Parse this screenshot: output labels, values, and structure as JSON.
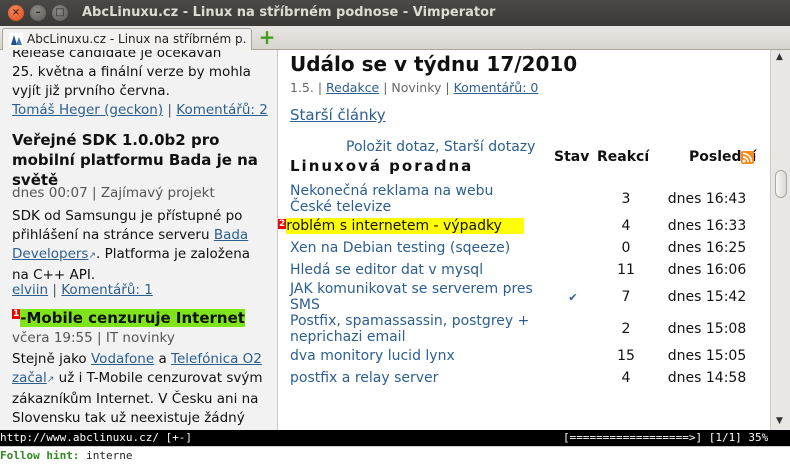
{
  "window": {
    "title": "AbcLinuxu.cz - Linux na stříbrném podnose - Vimperator"
  },
  "tabs": [
    {
      "label": "AbcLinuxu.cz - Linux na stříbrném p..."
    }
  ],
  "left": {
    "release_line1": "Release candidate je očekáván",
    "release_line2": "25. května a finální verze by mohla",
    "release_line3": "vyjít již prvního června.",
    "article1_author": "Tomáš Heger (geckon)",
    "article1_comments": "Komentářů: 2",
    "article2_title_l1": "Veřejné SDK 1.0.0b2 pro",
    "article2_title_l2": "mobilní platformu Bada je na",
    "article2_title_l3": "světě",
    "article2_meta_time": "dnes 00:07",
    "article2_meta_cat": "Zajímavý projekt",
    "article2_body_l1": "SDK od Samsungu je přístupné po",
    "article2_body_l2a": "přihlášení na stránce serveru",
    "article2_body_link1": "Bada",
    "article2_body_link2": "Developers",
    "article2_body_l3b": ". Platforma je založena",
    "article2_body_l4": "na C++ API.",
    "article2_author": "elviin",
    "article2_comments": "Komentářů: 1",
    "article3_hint": "1",
    "article3_title": "-Mobile cenzuruje Internet",
    "article3_meta_time": "včera 19:55",
    "article3_meta_cat": "IT novinky",
    "article3_body_l1a": "Stejně jako",
    "article3_link1": "Vodafone",
    "article3_body_a": "a",
    "article3_link2": "Telefónica O2",
    "article3_link3": "začal",
    "article3_body_l2b": " už i T-Mobile cenzurovat svým",
    "article3_body_l3": "zákazníkům Internet. V Česku ani na",
    "article3_body_l4": "Slovensku tak už neexistuje žádný"
  },
  "right": {
    "heading": "Událo se v týdnu 17/2010",
    "meta_date": "1.5.",
    "meta_link": "Redakce",
    "meta_cat": "Novinky",
    "meta_comments": "Komentářů: 0",
    "older": "Starší články",
    "ask": "Položit dotaz",
    "older_questions": "Starší dotazy",
    "section_title": "Linuxová poradna",
    "col_stav": "Stav",
    "col_reakci": "Reakcí",
    "col_posledni": "Poslední",
    "rows": [
      {
        "title_l1": "Nekonečná reklama na webu",
        "title_l2": "České televize",
        "count": "3",
        "time": "dnes 16:43"
      },
      {
        "hint": "2",
        "title_l1": "roblém s internetem - výpadky",
        "count": "4",
        "time": "dnes 16:33"
      },
      {
        "title_l1": "Xen na Debian testing (sqeeze)",
        "count": "0",
        "time": "dnes 16:25"
      },
      {
        "title_l1": "Hledá se editor dat v mysql",
        "count": "11",
        "time": "dnes 16:06"
      },
      {
        "title_l1": "JAK komunikovat se serverem pres",
        "title_l2": "SMS",
        "stav": "✔",
        "count": "7",
        "time": "dnes 15:42"
      },
      {
        "title_l1": "Postfix, spamassassin, postgrey +",
        "title_l2": "neprichazi email",
        "count": "2",
        "time": "dnes 15:08"
      },
      {
        "title_l1": "dva monitory lucid lynx",
        "count": "15",
        "time": "dnes 15:05"
      },
      {
        "title_l1": "postfix a relay server",
        "count": "4",
        "time": "dnes 14:58"
      }
    ]
  },
  "statusbar": {
    "url": "http://www.abclinuxu.cz/ [+-]",
    "progress": "[==================>] [1/1] 35%",
    "hint_label": "Follow hint:",
    "hint_value": "interne"
  },
  "colors": {
    "link": "#2c5f8f",
    "hint_green": "#7ee51d",
    "hint_yellow": "#ffff00",
    "hint_badge": "#ee0000"
  }
}
